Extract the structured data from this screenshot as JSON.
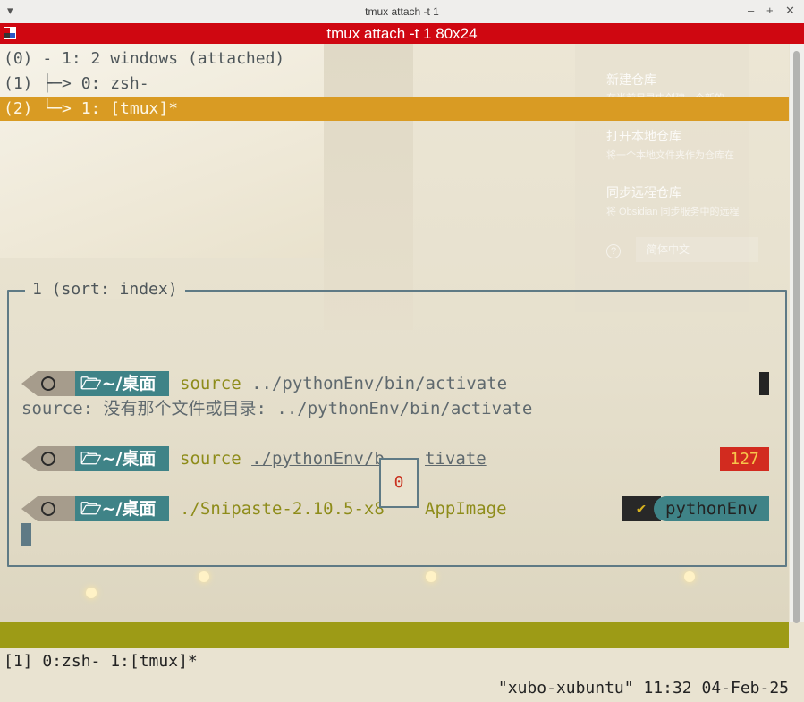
{
  "window": {
    "title": "tmux attach -t 1",
    "buttons": {
      "minimize": "–",
      "maximize": "+",
      "close": "✕",
      "menu": "▾"
    }
  },
  "terminal_title": "tmux attach -t 1 80x24",
  "tree": [
    {
      "text": "(0) - 1: 2 windows (attached)"
    },
    {
      "text": "(1) ├─> 0: zsh-"
    },
    {
      "text": "(2) └─> 1: [tmux]*"
    }
  ],
  "background_dialog": {
    "items": [
      {
        "title": "新建仓库",
        "desc": "在当前目录中创建一个新的"
      },
      {
        "title": "打开本地仓库",
        "desc": "将一个本地文件夹作为仓库在"
      },
      {
        "title": "同步远程仓库",
        "desc": "将 Obsidian 同步服务中的远程"
      }
    ],
    "language": "简体中文",
    "help_icon": "?"
  },
  "pane": {
    "title": "1 (sort: index)",
    "prompt_dir": "~/桌面",
    "lines": {
      "cmd1_keyword": "source",
      "cmd1_arg": "../pythonEnv/bin/activate",
      "error": "source: 没有那个文件或目录: ../pythonEnv/bin/activate",
      "cmd2_keyword": "source",
      "cmd2_arg_a": "./pythonEnv/b",
      "cmd2_arg_b": "tivate",
      "cmd3_a": "./Snipaste-2.10.5-x8",
      "cmd3_b": "AppImage"
    },
    "exit_code": "127",
    "venv_check": "✔",
    "venv_name": "pythonEnv",
    "popup_number": "0"
  },
  "status_bar": {
    "left": "[1] 0:zsh- 1:[tmux]*",
    "right": "\"xubo-xubuntu\" 11:32 04-Feb-25"
  },
  "colors": {
    "accent_red": "#cf0711",
    "selection": "#d99b23",
    "status": "#9d9b16",
    "teal": "#3f8387"
  }
}
